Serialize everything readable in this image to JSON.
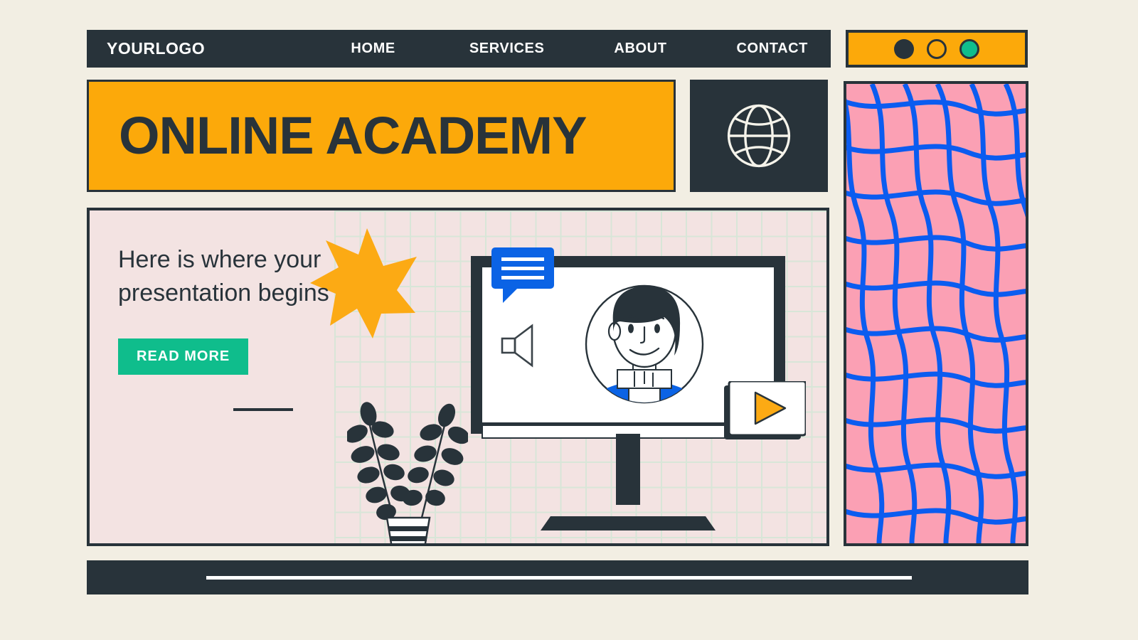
{
  "meta": {
    "accent_orange": "#fca90a",
    "dark": "#28333a",
    "green": "#0fbd8c",
    "blue": "#0b63e5",
    "pink_panel": "#fba0b4",
    "panel_bg": "#f3e3e2",
    "page_bg": "#f2eee3"
  },
  "navbar": {
    "logo": "YOURLOGO",
    "links": [
      {
        "label": "HOME"
      },
      {
        "label": "SERVICES"
      },
      {
        "label": "ABOUT"
      },
      {
        "label": "CONTACT"
      }
    ]
  },
  "window_dots": {
    "icons": [
      "circle-filled-icon",
      "circle-outline-icon",
      "circle-green-icon"
    ]
  },
  "banner": {
    "title": "ONLINE ACADEMY"
  },
  "globe": {
    "icon": "globe-icon"
  },
  "hero": {
    "headline": "Here is where your presentation begins",
    "cta_label": "READ MORE",
    "star_icon": "seven-point-star-icon",
    "divider": "horizontal-rule"
  },
  "illustration": {
    "monitor_icon": "desktop-monitor-icon",
    "chat_bubble_icon": "chat-bubble-icon",
    "speaker_icon": "speaker-icon",
    "avatar_icon": "person-avatar-icon",
    "play_icon": "play-button-icon",
    "plant_icon": "potted-plant-icon"
  },
  "decor": {
    "wavy_grid": "wavy-grid-pattern"
  }
}
